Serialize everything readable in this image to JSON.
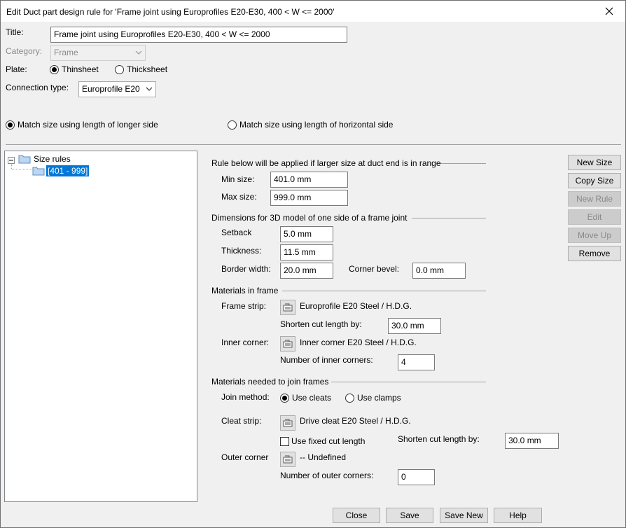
{
  "window": {
    "title": "Edit Duct part design rule for 'Frame joint using Europrofiles  E20-E30,  400 < W <= 2000'"
  },
  "form": {
    "title_label": "Title:",
    "title_value": "Frame joint using Europrofiles  E20-E30,  400 < W <= 2000",
    "category_label": "Category:",
    "category_value": "Frame",
    "plate_label": "Plate:",
    "plate_thin": "Thinsheet",
    "plate_thick": "Thicksheet",
    "conn_label": "Connection type:",
    "conn_value": "Europrofile E20",
    "match_longer": "Match size using length of longer side",
    "match_horizontal": "Match size using length of horizontal side"
  },
  "tree": {
    "root": "Size rules",
    "child": "[401 - 999]"
  },
  "range": {
    "header": "Rule below will be applied if larger size at duct end is in range",
    "min_label": "Min size:",
    "min_value": "401.0 mm",
    "max_label": "Max size:",
    "max_value": "999.0 mm"
  },
  "dims": {
    "header": "Dimensions for 3D model of one side of a frame joint",
    "setback_label": "Setback",
    "setback_value": "5.0 mm",
    "thickness_label": "Thickness:",
    "thickness_value": "11.5 mm",
    "border_label": "Border width:",
    "border_value": "20.0 mm",
    "bevel_label": "Corner bevel:",
    "bevel_value": "0.0 mm"
  },
  "materials": {
    "header": "Materials in frame",
    "strip_label": "Frame strip:",
    "strip_value": "Europrofile E20 Steel / H.D.G.",
    "shorten_label": "Shorten cut length by:",
    "shorten_value": "30.0 mm",
    "inner_label": "Inner corner:",
    "inner_value": "Inner corner E20 Steel / H.D.G.",
    "num_inner_label": "Number of inner corners:",
    "num_inner_value": "4"
  },
  "join": {
    "header": "Materials needed to join frames",
    "method_label": "Join method:",
    "cleats": "Use cleats",
    "clamps": "Use clamps",
    "cleat_label": "Cleat strip:",
    "cleat_value": "Drive cleat E20 Steel / H.D.G.",
    "fixed_cut": "Use fixed cut length",
    "shorten_label": "Shorten cut length by:",
    "shorten_value": "30.0 mm",
    "outer_label": "Outer corner",
    "outer_value": "-- Undefined",
    "num_outer_label": "Number of outer corners:",
    "num_outer_value": "0"
  },
  "side_buttons": {
    "new_size": "New Size",
    "copy_size": "Copy Size",
    "new_rule": "New Rule",
    "edit": "Edit",
    "move_up": "Move Up",
    "remove": "Remove"
  },
  "footer": {
    "close": "Close",
    "save": "Save",
    "save_new": "Save New",
    "help": "Help"
  },
  "icons": {
    "close": "close-icon",
    "dropdown": "chevron-down-icon",
    "folder": "folder-icon",
    "picker": "picker-icon"
  }
}
